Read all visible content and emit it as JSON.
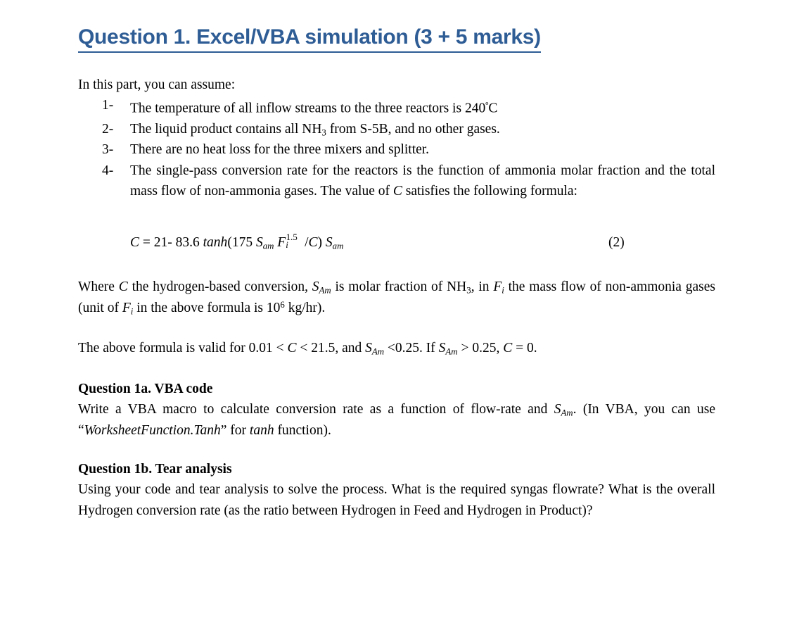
{
  "document": {
    "title": "Question 1. Excel/VBA simulation (3 + 5 marks)",
    "title_color": "#2E5C95",
    "intro": "In this part, you can assume:",
    "assumptions": [
      {
        "marker": "1-",
        "text_before": "The temperature of all inflow streams to the three reactors is 240",
        "degree": "º",
        "text_after": "C"
      },
      {
        "marker": "2-",
        "text_before": "The liquid product contains all NH",
        "sub": "3",
        "text_after": " from S-5B, and no other gases."
      },
      {
        "marker": "3-",
        "text": "There are no heat loss for the three mixers and splitter."
      },
      {
        "marker": "4-",
        "part1": "The single-pass conversion rate for the reactors is the function of ammonia molar fraction and the total mass flow of non-ammonia gases. The value of ",
        "var_c": "C",
        "part2": " satisfies the following formula:"
      }
    ],
    "equation": {
      "lhs_var": "C",
      "eq_sign": " = ",
      "const1": "21- 83.6 ",
      "func": "tanh",
      "open_paren": "(",
      "coef": "175 ",
      "s_base": "S",
      "s_sub": "am",
      "f_base": "F",
      "f_sub": "i",
      "f_sup": "1.5",
      "slash": " /",
      "c_inner": "C",
      "close_paren": ") ",
      "s_base2": "S",
      "s_sub2": "am",
      "number": "(2)"
    },
    "where_paragraph": {
      "p1": "Where ",
      "v_c": "C",
      "p2": " the hydrogen-based conversion, ",
      "v_s": "S",
      "v_s_sub": "Am",
      "p3": " is molar fraction of NH",
      "nh3_sub": "3",
      "p4": ", in ",
      "v_f": "F",
      "v_f_sub": "i",
      "p5": " the mass flow of non-ammonia gases (unit of ",
      "v_f2": "F",
      "v_f2_sub": "i",
      "p6": " in the above formula is 10",
      "exp6": "6",
      "p7": " kg/hr)."
    },
    "validity": {
      "p1": "The above formula is valid for 0.01 < ",
      "v_c1": "C",
      "p2": " < 21.5, and  ",
      "v_s1": "S",
      "v_s1_sub": "Am",
      "p3": " <0.25. If ",
      "v_s2": "S",
      "v_s2_sub": "Am",
      "p4": " > 0.25, ",
      "v_c2": "C",
      "p5": " = 0."
    },
    "section_a": {
      "heading": "Question 1a. VBA code",
      "p1": "Write a VBA macro to calculate conversion rate as a function of flow-rate and ",
      "v_s": "S",
      "v_s_sub": "Am",
      "p2": ". (In VBA, you can use “",
      "func_name": "WorksheetFunction.Tanh",
      "p3": "” for ",
      "func_tanh": "tanh",
      "p4": " function)."
    },
    "section_b": {
      "heading": "Question 1b. Tear analysis",
      "text": "Using your code and tear analysis to solve the process. What is the required syngas flowrate? What is the overall Hydrogen conversion rate (as the ratio between Hydrogen in Feed and Hydrogen in Product)?"
    }
  }
}
